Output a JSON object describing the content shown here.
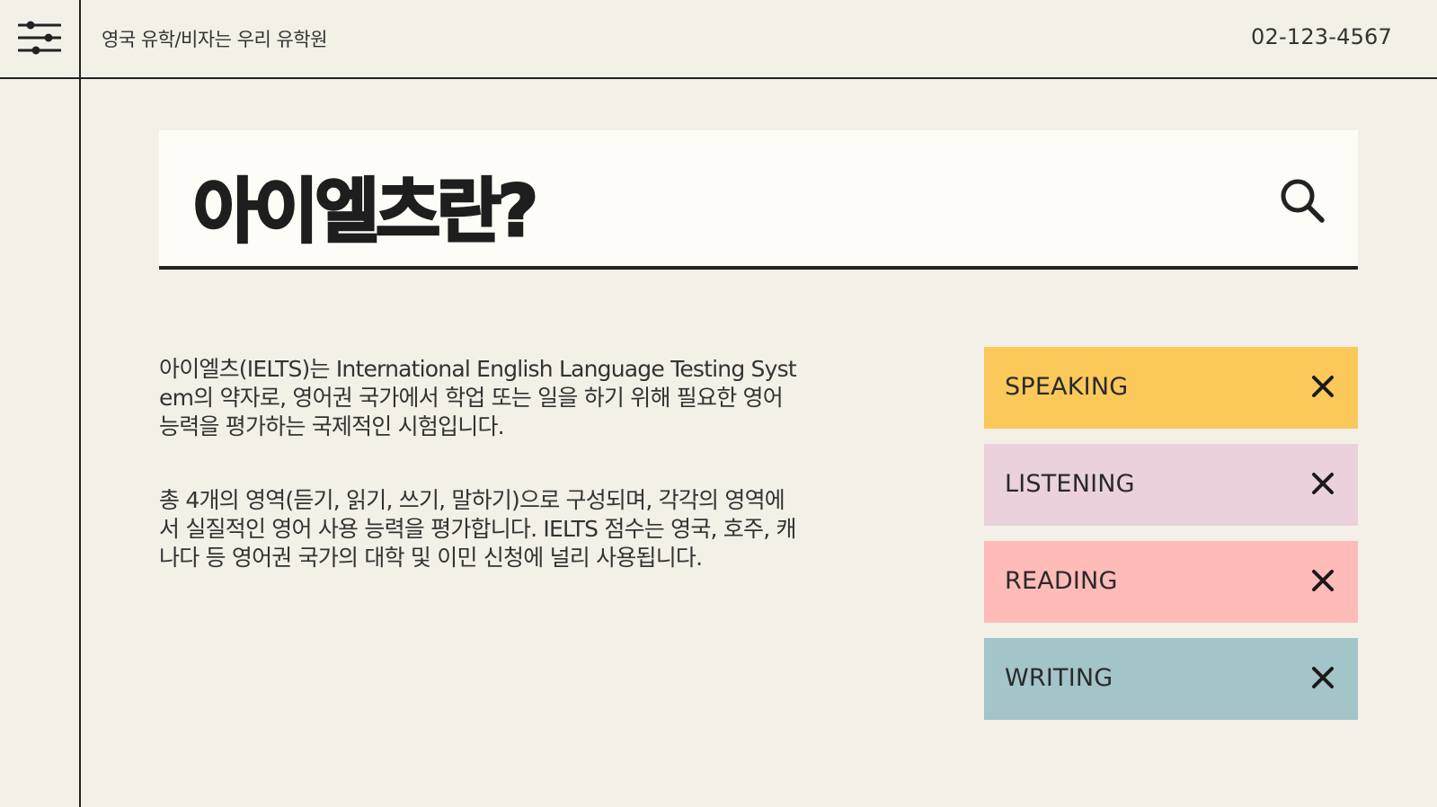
{
  "header": {
    "site_title": "영국 유학/비자는 우리 유학원",
    "phone": "02-123-4567",
    "menu_icon": "sliders-menu-icon"
  },
  "hero": {
    "heading": "아이엘츠란?",
    "search_icon": "search-icon"
  },
  "description": {
    "paragraphs": [
      "아이엘츠(IELTS)는 International English Language Testing System의 약자로, 영어권 국가에서 학업 또는 일을 하기 위해 필요한 영어 능력을 평가하는 국제적인 시험입니다.",
      "총 4개의 영역(듣기, 읽기, 쓰기, 말하기)으로 구성되며, 각각의 영역에서 실질적인 영어 사용 능력을 평가합니다. IELTS 점수는 영국, 호주, 캐나다 등 영어권 국가의 대학 및 이민 신청에 널리 사용됩니다."
    ]
  },
  "skills": [
    {
      "label": "SPEAKING",
      "color": "#fbc95a",
      "icon": "close-icon"
    },
    {
      "label": "LISTENING",
      "color": "#ead1dc",
      "icon": "close-icon"
    },
    {
      "label": "READING",
      "color": "#febbb8",
      "icon": "close-icon"
    },
    {
      "label": "WRITING",
      "color": "#a3c4c8",
      "icon": "close-icon"
    }
  ],
  "colors": {
    "background": "#f3f0e8",
    "panel": "#fdfcf6",
    "ink": "#222222"
  }
}
